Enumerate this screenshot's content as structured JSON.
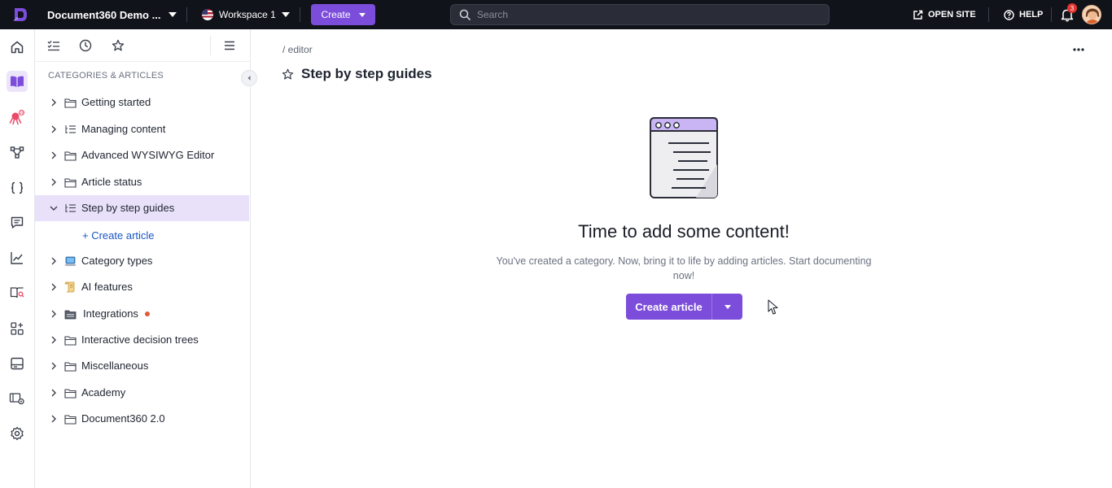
{
  "topbar": {
    "project_name": "Document360 Demo ...",
    "workspace": "Workspace 1",
    "create_label": "Create",
    "search_placeholder": "Search",
    "open_site_label": "OPEN SITE",
    "help_label": "HELP",
    "notification_count": "3"
  },
  "rail": {
    "items": [
      "home-icon",
      "book-icon",
      "bug-icon",
      "flow-icon",
      "braces-icon",
      "chat-icon",
      "analytics-icon",
      "book-search-icon",
      "widgets-icon",
      "panel-icon",
      "settings-screen-icon",
      "gear-icon"
    ]
  },
  "sidebar": {
    "heading": "CATEGORIES & ARTICLES",
    "items": [
      {
        "label": "Getting started",
        "icon": "folder-icon"
      },
      {
        "label": "Managing content",
        "icon": "list-tree-icon"
      },
      {
        "label": "Advanced WYSIWYG Editor",
        "icon": "folder-icon"
      },
      {
        "label": "Article status",
        "icon": "folder-icon"
      },
      {
        "label": "Step by step guides",
        "icon": "list-tree-icon"
      },
      {
        "label": "Category types",
        "icon": "laptop-emoji-icon"
      },
      {
        "label": "AI features",
        "icon": "scroll-emoji-icon"
      },
      {
        "label": "Integrations",
        "icon": "dark-folder-icon"
      },
      {
        "label": "Interactive decision trees",
        "icon": "folder-icon"
      },
      {
        "label": "Miscellaneous",
        "icon": "folder-icon"
      },
      {
        "label": "Academy",
        "icon": "folder-icon"
      },
      {
        "label": "Document360 2.0",
        "icon": "folder-icon"
      }
    ],
    "create_article_label": "+ Create article"
  },
  "main": {
    "breadcrumb": "/ editor",
    "title": "Step by step guides",
    "empty_title": "Time to add some content!",
    "empty_desc": "You've created a category. Now, bring it to life by adding articles. Start documenting now!",
    "cta_label": "Create article"
  },
  "colors": {
    "accent": "#7c4ddb",
    "topbar": "#11131a",
    "active_row": "#e9e1fa",
    "link": "#1a56c4"
  }
}
